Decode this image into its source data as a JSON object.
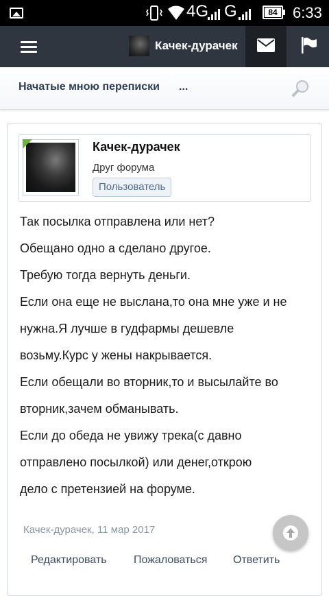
{
  "statusbar": {
    "network1": "4G",
    "network2": "G",
    "battery": "84",
    "time": "6:33",
    "icons": [
      "gallery-icon",
      "vibrate-icon",
      "wifi-icon",
      "signal-icon",
      "signal-icon",
      "battery-icon"
    ]
  },
  "header": {
    "username": "Качек-дурачек",
    "icons": [
      "menu-icon",
      "envelope-icon",
      "flag-icon"
    ],
    "colors": {
      "bar": "#2f3640",
      "active": "#1d2126"
    }
  },
  "subheader": {
    "title": "Начатые мною переписки",
    "more": "...",
    "search_icon": "search-icon"
  },
  "post": {
    "author": "Качек-дурачек",
    "title": "Друг форума",
    "role_badge": "Пользователь",
    "lines": [
      "Так посылка отправлена или нет?",
      "Обещано одно а сделано другое.",
      "Требую тогда вернуть деньги.",
      "Если она еще не выслана,то она мне уже и не",
      "нужна.Я лучше в гудфармы дешевле",
      "возьму.Курс у жены накрывается.",
      "Если обещали во вторник,то и высылайте во",
      "вторник,зачем обманывать.",
      "Если до обеда не увижу трека(с давно",
      "отправлено посылкой) или денег,открою",
      "дело с претензией на форуме."
    ],
    "meta": "Качек-дурачек, 11 мар 2017",
    "actions": {
      "edit": "Редактировать",
      "report": "Пожаловаться",
      "reply": "Ответить"
    }
  },
  "scroll_top_icon": "arrow-up-icon"
}
